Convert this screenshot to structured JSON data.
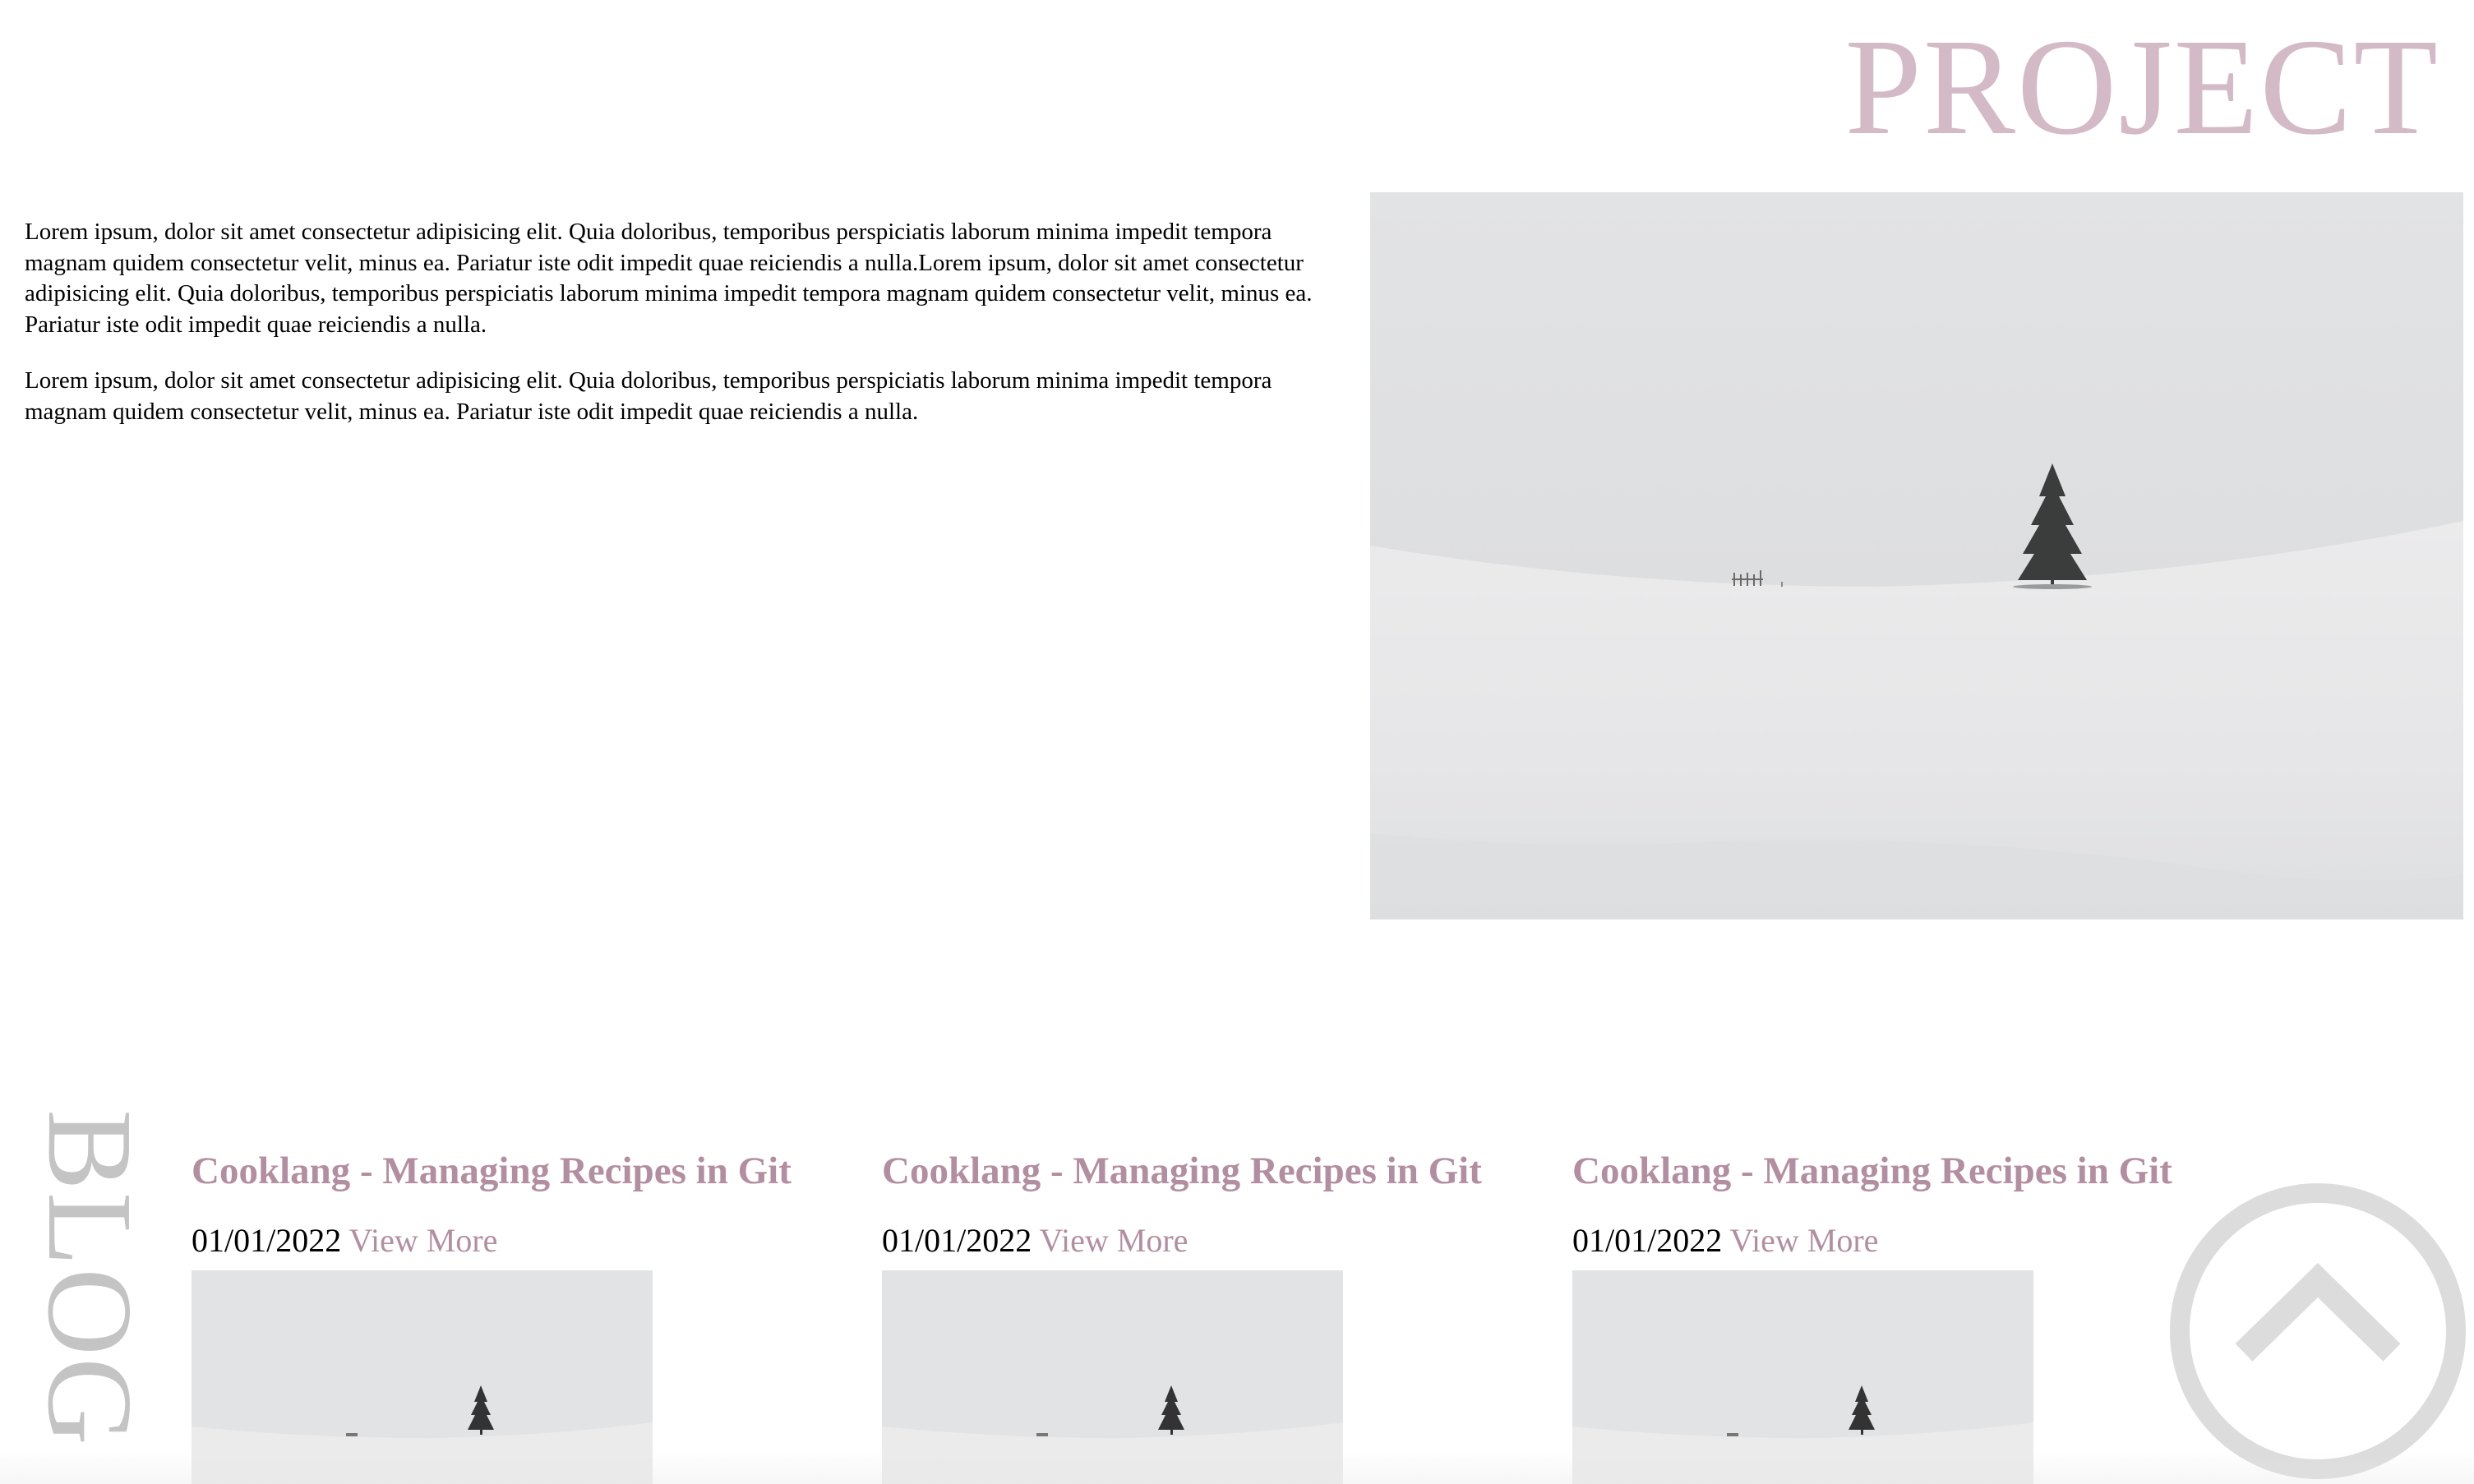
{
  "project": {
    "title": "PROJECT",
    "paragraphs": [
      "Lorem ipsum, dolor sit amet consectetur adipisicing elit. Quia doloribus, temporibus perspiciatis laborum minima impedit tempora magnam quidem consectetur velit, minus ea. Pariatur iste odit impedit quae reiciendis a nulla.Lorem ipsum, dolor sit amet consectetur adipisicing elit. Quia doloribus, temporibus perspiciatis laborum minima impedit tempora magnam quidem consectetur velit, minus ea. Pariatur iste odit impedit quae reiciendis a nulla.",
      "Lorem ipsum, dolor sit amet consectetur adipisicing elit. Quia doloribus, temporibus perspiciatis laborum minima impedit tempora magnam quidem consectetur velit, minus ea. Pariatur iste odit impedit quae reiciendis a nulla."
    ],
    "image": "snowy-landscape-lone-tree"
  },
  "blog": {
    "label": "BLOG",
    "posts": [
      {
        "title": "Cooklang - Managing Recipes in Git",
        "date": "01/01/2022",
        "link": "View More",
        "image": "snowy-landscape-lone-tree"
      },
      {
        "title": "Cooklang - Managing Recipes in Git",
        "date": "01/01/2022",
        "link": "View More",
        "image": "snowy-landscape-lone-tree"
      },
      {
        "title": "Cooklang - Managing Recipes in Git",
        "date": "01/01/2022",
        "link": "View More",
        "image": "snowy-landscape-lone-tree"
      }
    ]
  },
  "back_to_top": {
    "icon": "chevron-up-circle-icon"
  },
  "colors": {
    "project_title": "#d4bac6",
    "accent": "#b38ea0",
    "blog_label": "#c4c4c4",
    "back_to_top": "#dcdcdc"
  }
}
